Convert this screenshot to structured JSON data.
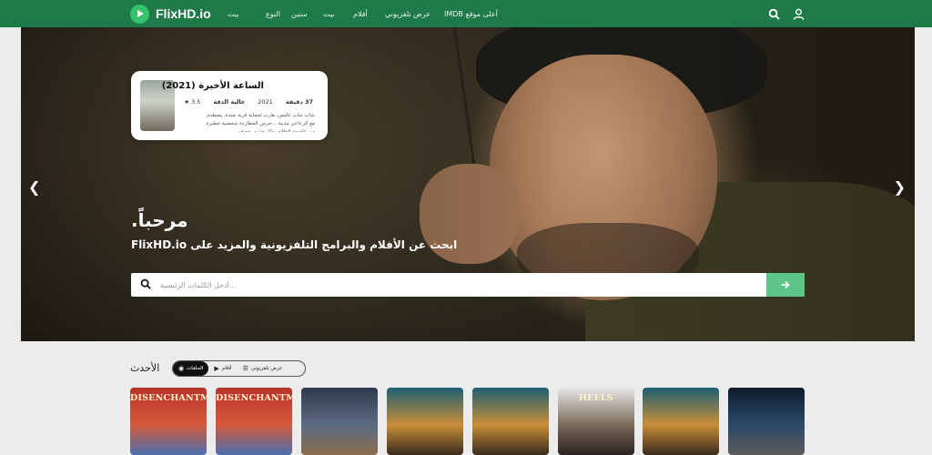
{
  "brand": {
    "name": "FlixHD.io",
    "accent": "#1f7a4a",
    "button": "#5cc68a"
  },
  "nav": {
    "items": [
      "IMDB أعلى موقع",
      "عرض تلفزيوني",
      "أفلام",
      "بيت",
      "سنين",
      "النوع",
      "بيت"
    ]
  },
  "icons": {
    "search": "search-icon",
    "user": "user-icon"
  },
  "featured": {
    "title": "الساعة الأخيرة (2021)",
    "duration": "37 دقيقة",
    "year": "2021",
    "quality": "عالية الدقة",
    "rating": "3.5",
    "description": "شاب شاب غامض، هارب لحماية قرية بعيدة، يصطدم مع الرعاعي مدينة ...حرس المطاردة شخصية خطيرة من عاصمة الظلام، وكل جندي يقع في"
  },
  "hero": {
    "welcome": "مرحباً.",
    "tagline": "ابحث عن الأفلام والبرامج التلفزيونية والمزيد على FlixHD.io",
    "search_placeholder": "أدخل الكلمات الرئيسية..."
  },
  "latest": {
    "title": "الأحدث",
    "tabs": [
      {
        "label": "الحلقات",
        "icon": "play-circle-icon",
        "active": true
      },
      {
        "label": "أفلام",
        "icon": "play-icon",
        "active": false
      },
      {
        "label": "عرض تلفزيوني",
        "icon": "list-icon",
        "active": false
      }
    ],
    "posters": [
      {
        "title": "DISENCHANTMENT",
        "colors": [
          "#b8302a",
          "#d45a3a",
          "#4a6fb0"
        ]
      },
      {
        "title": "DISENCHANTMENT",
        "colors": [
          "#b8302a",
          "#d45a3a",
          "#4a6fb0"
        ]
      },
      {
        "title": "",
        "colors": [
          "#2f3a4e",
          "#5c6a82",
          "#8a6d4e"
        ]
      },
      {
        "title": "",
        "colors": [
          "#1e5f73",
          "#c98e3a",
          "#3a2a1c"
        ]
      },
      {
        "title": "",
        "colors": [
          "#1e5f73",
          "#c98e3a",
          "#3a2a1c"
        ]
      },
      {
        "title": "HEELS",
        "colors": [
          "#e8e8e8",
          "#7a6a5a",
          "#2a2220"
        ]
      },
      {
        "title": "",
        "colors": [
          "#1e5f73",
          "#c98e3a",
          "#3a2a1c"
        ]
      },
      {
        "title": "",
        "colors": [
          "#0f1a2a",
          "#2c4a6a",
          "#5a5a5a"
        ]
      }
    ]
  }
}
